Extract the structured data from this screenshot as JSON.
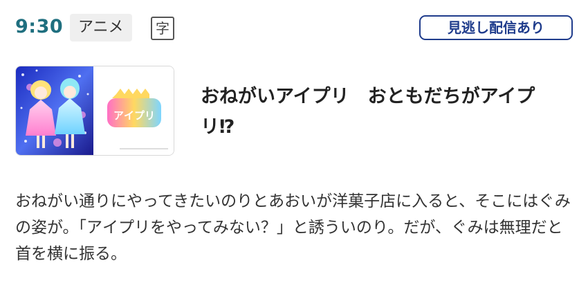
{
  "program": {
    "time": "9:30",
    "genre": "アニメ",
    "subtitle_mark": "字",
    "catchup_label": "見逃し配信あり",
    "title": "おねがいアイプリ　おともだちがアイプリ⁉",
    "description": "おねがい通りにやってきたいのりとあおいが洋菓子店に入ると、そこにはぐみの姿が。「アイプリをやってみない？」と誘ういのり。だが、ぐみは無理だと首を横に振る。"
  },
  "thumbnail": {
    "logo_text": "アイプリ",
    "icon": "anime-key-visual-image"
  },
  "colors": {
    "time": "#1f6f7f",
    "catchup_border": "#1f3c8c",
    "genre_bg": "#efefef"
  }
}
